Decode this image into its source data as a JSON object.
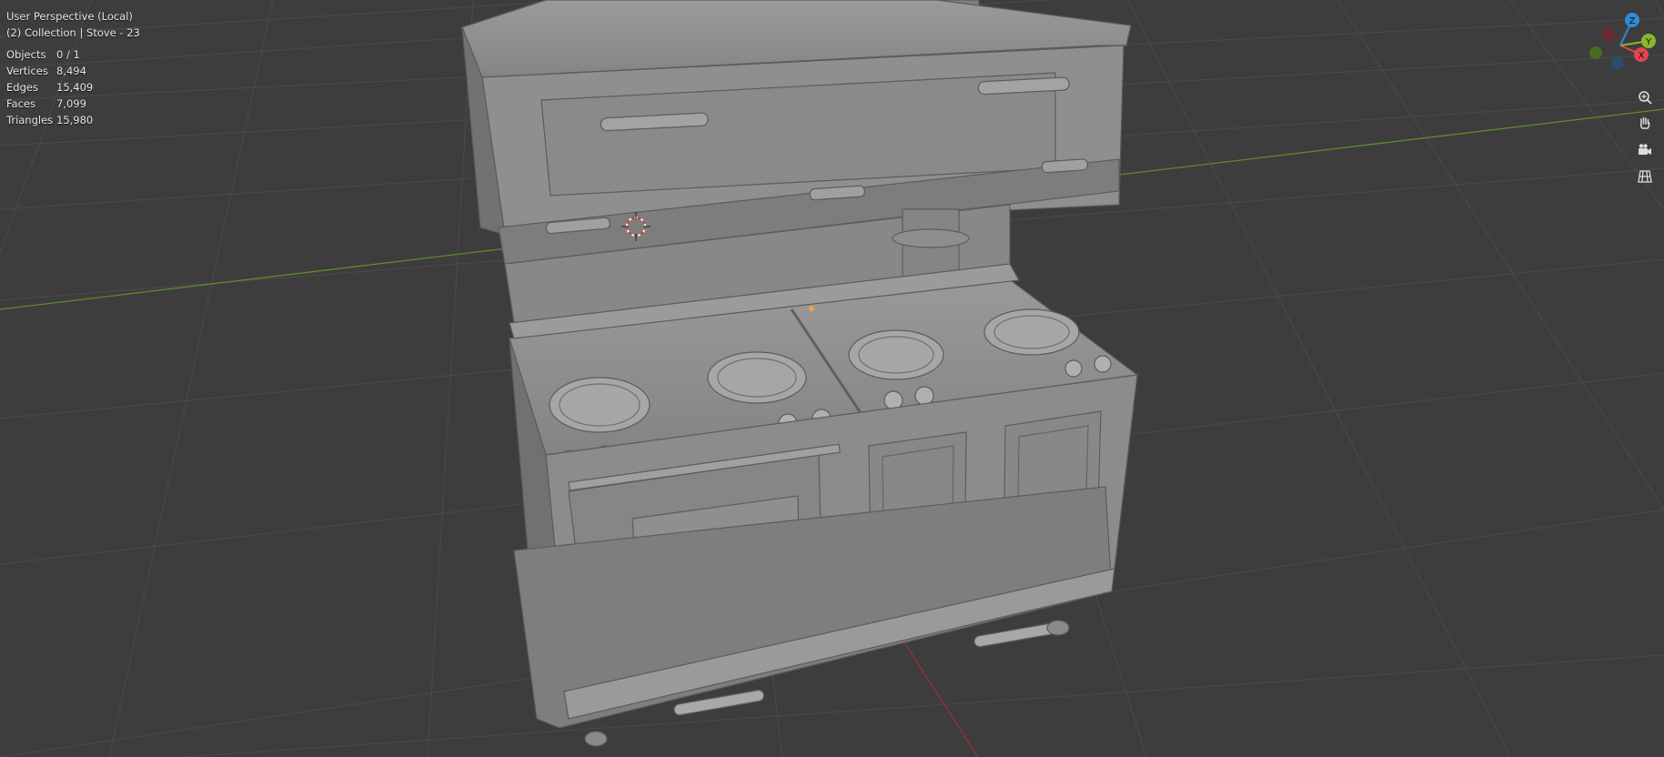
{
  "viewport": {
    "header": {
      "perspective": "User Perspective (Local)",
      "collection": "(2) Collection | Stove - 23"
    },
    "stats": [
      {
        "label": "Objects",
        "value": "0 / 1"
      },
      {
        "label": "Vertices",
        "value": "8,494"
      },
      {
        "label": "Edges",
        "value": "15,409"
      },
      {
        "label": "Faces",
        "value": "7,099"
      },
      {
        "label": "Triangles",
        "value": "15,980"
      }
    ]
  },
  "gizmo": {
    "x_label": "X",
    "y_label": "Y",
    "z_label": "Z",
    "colors": {
      "x": "#e3454f",
      "y": "#89b72a",
      "z": "#2f8ad8"
    }
  },
  "nav_buttons": [
    "zoom-icon",
    "pan-hand-icon",
    "camera-icon",
    "grid-view-icon"
  ],
  "colors": {
    "background": "#3d3d3d",
    "grid": "#505050",
    "model": "#8a8a8a",
    "x_axis": "#9a3038",
    "y_axis": "#5e8a2a"
  }
}
